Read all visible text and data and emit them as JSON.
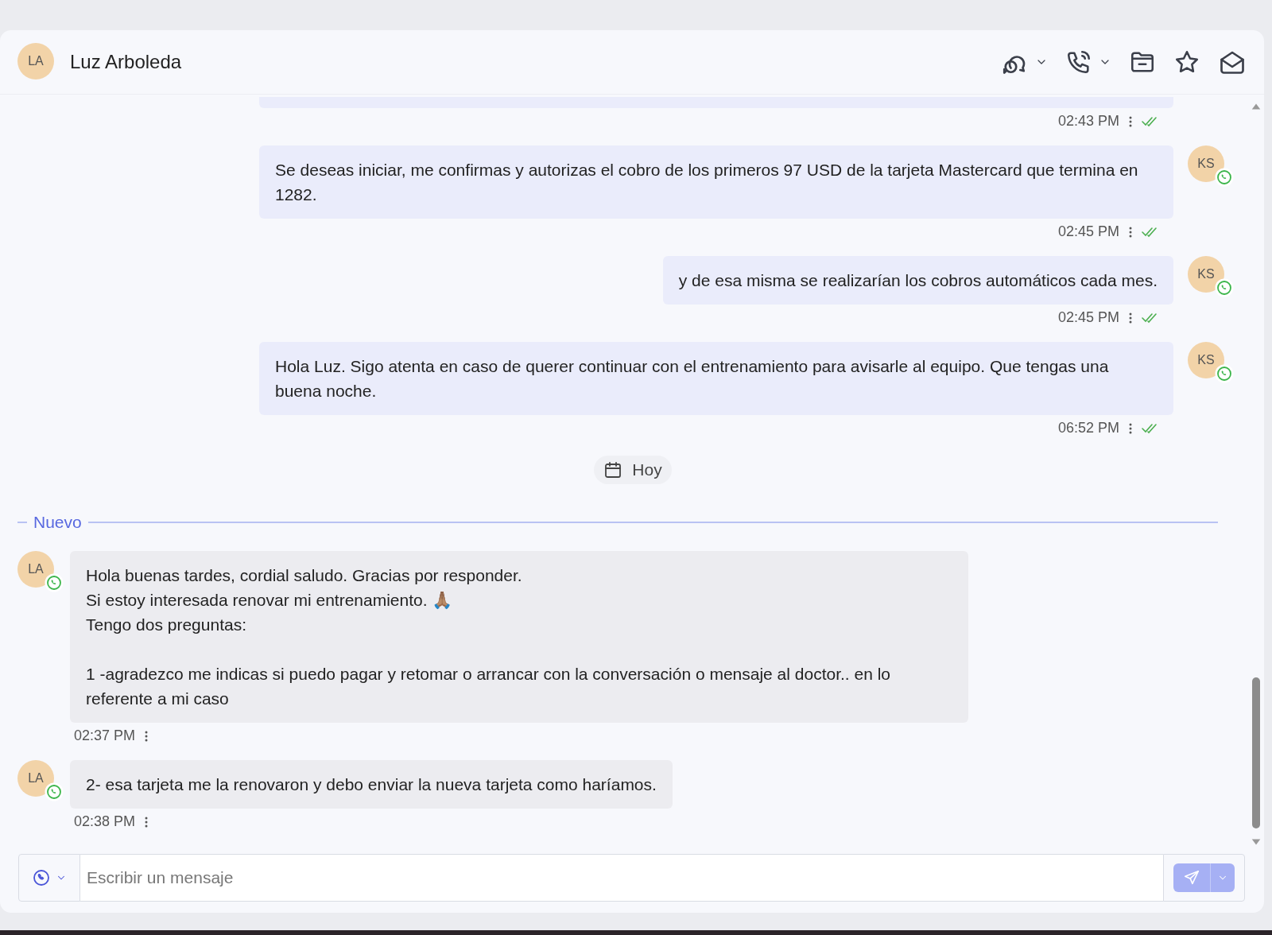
{
  "contact": {
    "initials": "LA",
    "name": "Luz Arboleda"
  },
  "messages": [
    {
      "kind": "outgoing",
      "time": "02:43 PM",
      "read": true
    },
    {
      "kind": "outgoing",
      "initials": "KS",
      "text": "Se deseas iniciar, me confirmas y autorizas el cobro de los primeros 97 USD de la tarjeta Mastercard que termina en 1282.",
      "time": "02:45 PM",
      "read": true
    },
    {
      "kind": "outgoing",
      "initials": "KS",
      "text": "y de esa misma se realizarían los cobros automáticos cada mes.",
      "time": "02:45 PM",
      "read": true
    },
    {
      "kind": "outgoing",
      "initials": "KS",
      "text": "Hola Luz. Sigo atenta en caso de querer continuar con el entrenamiento para avisarle al equipo. Que tengas una buena noche.",
      "time": "06:52 PM",
      "read": true
    },
    {
      "kind": "date",
      "text": "Hoy"
    },
    {
      "kind": "divider",
      "text": "Nuevo"
    },
    {
      "kind": "incoming",
      "initials": "LA",
      "text": "Hola buenas tardes, cordial saludo. Gracias por responder.\nSi estoy interesada renovar mi entrenamiento. 🙏🏽\nTengo dos preguntas:\n\n1 -agradezco me indicas si puedo pagar y retomar o arrancar con la conversación o mensaje al doctor.. en lo referente a mi caso",
      "time": "02:37 PM"
    },
    {
      "kind": "incoming",
      "initials": "LA",
      "text": "2- esa tarjeta me la renovaron y debo enviar la nueva tarjeta como haríamos.",
      "time": "02:38 PM"
    }
  ],
  "composer": {
    "placeholder": "Escribir un mensaje"
  }
}
